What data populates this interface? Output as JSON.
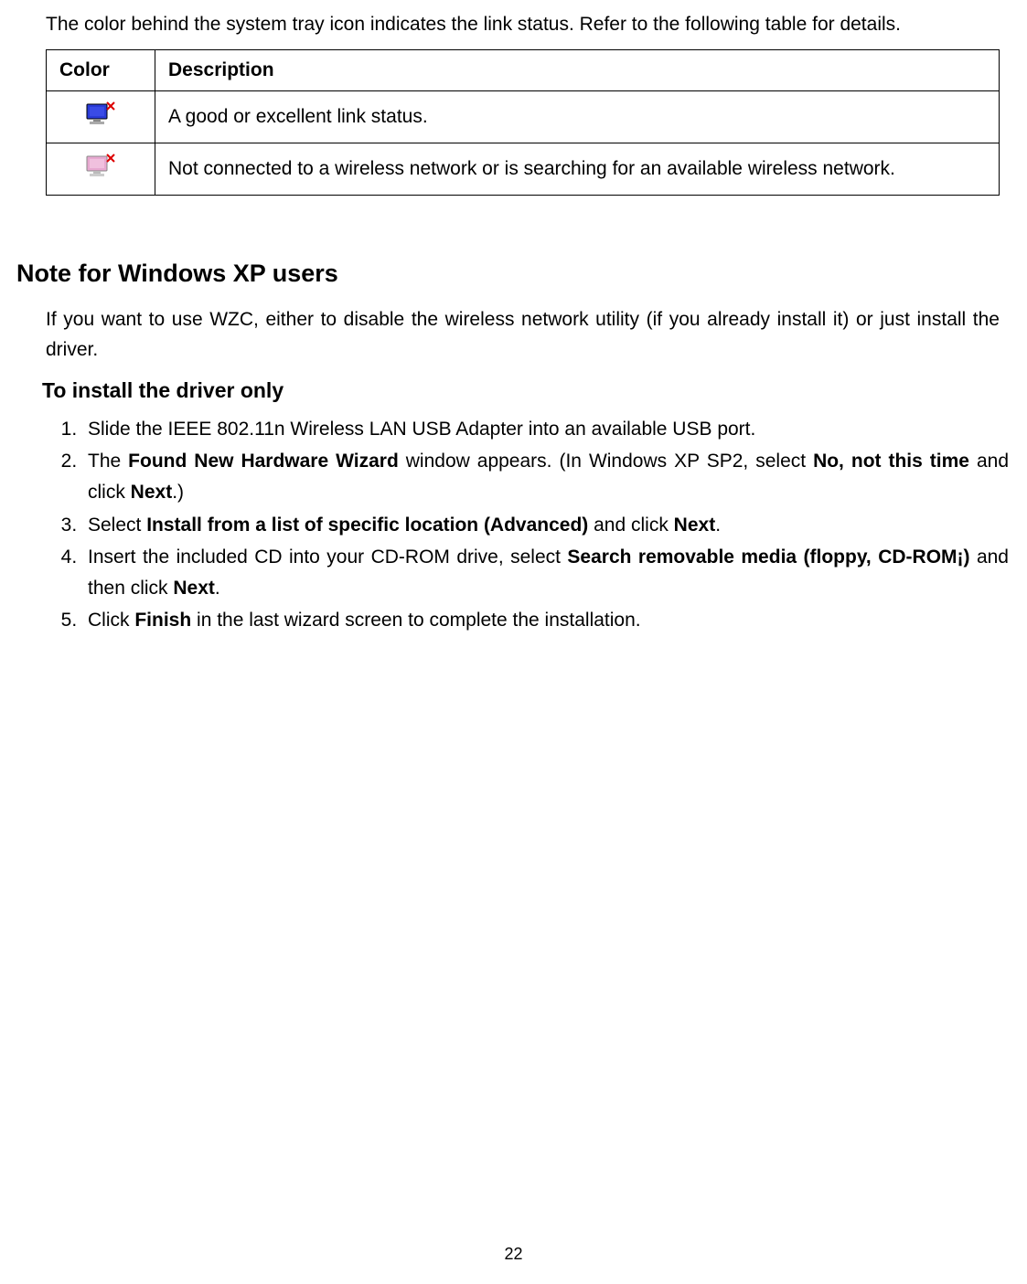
{
  "intro": "The color behind the system tray icon indicates the link status. Refer to the following table for details.",
  "table": {
    "headers": {
      "col1": "Color",
      "col2": "Description"
    },
    "rows": [
      {
        "icon": "tray-icon-blue",
        "desc": "A good or excellent link status."
      },
      {
        "icon": "tray-icon-pink",
        "desc": "Not connected to a wireless network or is searching for an available wireless network."
      }
    ]
  },
  "section_title": "Note for Windows XP users",
  "section_p": "If you want to use WZC, either to disable the wireless network utility (if you already install it) or just install the driver.",
  "subsection_title": "To install the driver only",
  "steps": [
    {
      "parts": [
        {
          "t": "Slide the IEEE 802.11n Wireless LAN USB Adapter into an available USB port."
        }
      ]
    },
    {
      "parts": [
        {
          "t": "The "
        },
        {
          "t": "Found New Hardware Wizard",
          "b": true
        },
        {
          "t": " window appears. (In Windows XP SP2, select "
        },
        {
          "t": "No, not this time",
          "b": true
        },
        {
          "t": " and click "
        },
        {
          "t": "Next",
          "b": true
        },
        {
          "t": ".)"
        }
      ]
    },
    {
      "parts": [
        {
          "t": "Select "
        },
        {
          "t": "Install from a list of specific location (Advanced)",
          "b": true
        },
        {
          "t": " and click "
        },
        {
          "t": "Next",
          "b": true
        },
        {
          "t": "."
        }
      ]
    },
    {
      "parts": [
        {
          "t": "Insert the included CD into your CD-ROM drive, select "
        },
        {
          "t": "Search removable media (floppy, CD-ROM¡­)",
          "b": true
        },
        {
          "t": " and then click "
        },
        {
          "t": "Next",
          "b": true
        },
        {
          "t": "."
        }
      ]
    },
    {
      "parts": [
        {
          "t": "Click "
        },
        {
          "t": "Finish",
          "b": true
        },
        {
          "t": " in the last wizard screen to complete the installation."
        }
      ]
    }
  ],
  "page_number": "22"
}
